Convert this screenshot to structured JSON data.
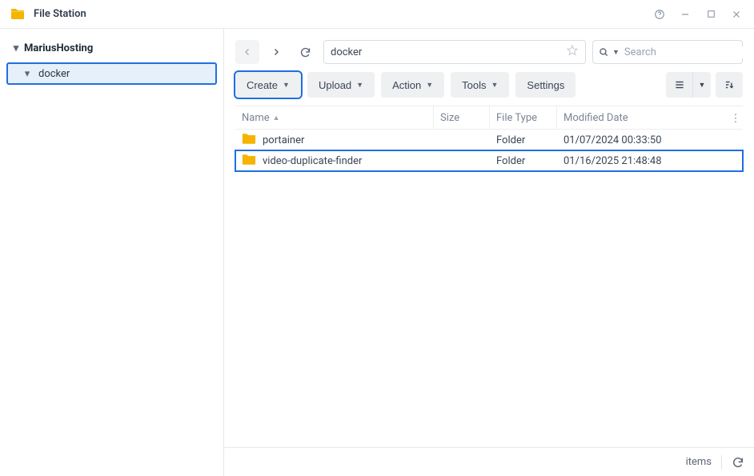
{
  "app": {
    "title": "File Station"
  },
  "sidebar": {
    "root": "MariusHosting",
    "items": [
      {
        "label": "docker",
        "selected": true
      }
    ]
  },
  "path": {
    "value": "docker"
  },
  "search": {
    "placeholder": "Search"
  },
  "toolbar": {
    "create": "Create",
    "upload": "Upload",
    "action": "Action",
    "tools": "Tools",
    "settings": "Settings"
  },
  "columns": {
    "name": "Name",
    "size": "Size",
    "type": "File Type",
    "date": "Modified Date"
  },
  "rows": [
    {
      "name": "portainer",
      "type": "Folder",
      "date": "01/07/2024 00:33:50",
      "selected": false
    },
    {
      "name": "video-duplicate-finder",
      "type": "Folder",
      "date": "01/16/2025 21:48:48",
      "selected": true
    }
  ],
  "status": {
    "items_label": "items"
  }
}
